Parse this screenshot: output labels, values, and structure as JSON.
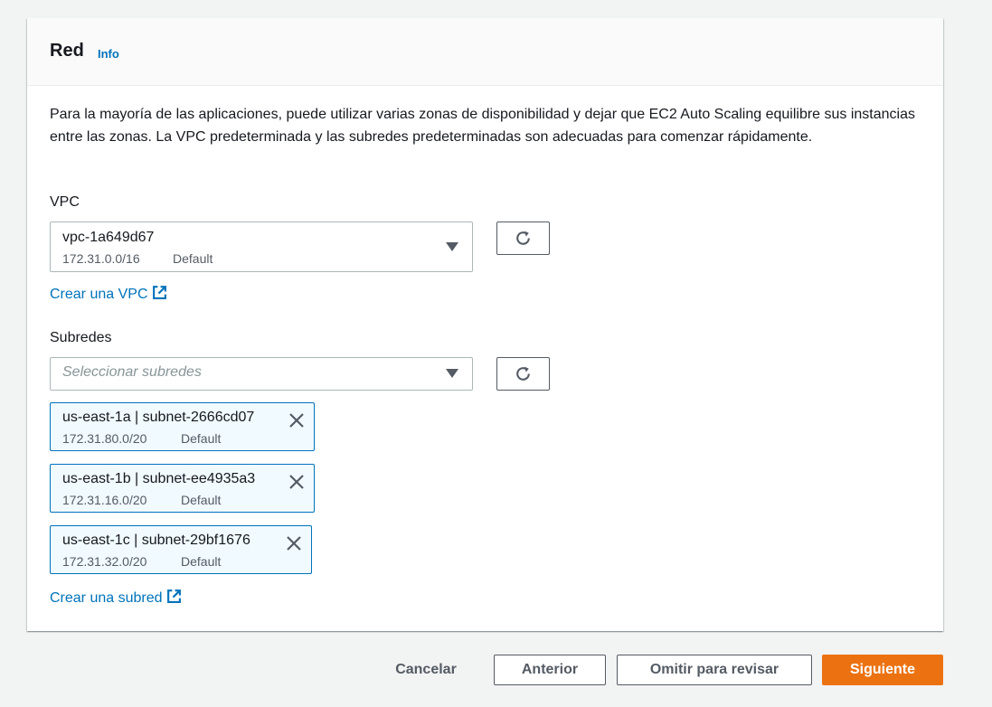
{
  "panel": {
    "title": "Red",
    "info_label": "Info",
    "description": "Para la mayoría de las aplicaciones, puede utilizar varias zonas de disponibilidad y dejar que EC2 Auto Scaling equilibre sus instancias entre las zonas. La VPC predeterminada y las subredes predeterminadas son adecuadas para comenzar rápidamente."
  },
  "vpc": {
    "label": "VPC",
    "selected_value": "vpc-1a649d67",
    "selected_cidr": "172.31.0.0/16",
    "selected_tag": "Default",
    "create_link": "Crear una VPC",
    "refresh_icon": "refresh-icon"
  },
  "subnets": {
    "label": "Subredes",
    "placeholder": "Seleccionar subredes",
    "create_link": "Crear una subred",
    "tokens": [
      {
        "name": "us-east-1a | subnet-2666cd07",
        "cidr": "172.31.80.0/20",
        "tag": "Default"
      },
      {
        "name": "us-east-1b | subnet-ee4935a3",
        "cidr": "172.31.16.0/20",
        "tag": "Default"
      },
      {
        "name": "us-east-1c | subnet-29bf1676",
        "cidr": "172.31.32.0/20",
        "tag": "Default"
      }
    ]
  },
  "footer": {
    "cancel": "Cancelar",
    "previous": "Anterior",
    "skip": "Omitir para revisar",
    "next": "Siguiente"
  },
  "colors": {
    "link": "#0073bb",
    "primary": "#ec7211",
    "token_bg": "#f1faff"
  }
}
